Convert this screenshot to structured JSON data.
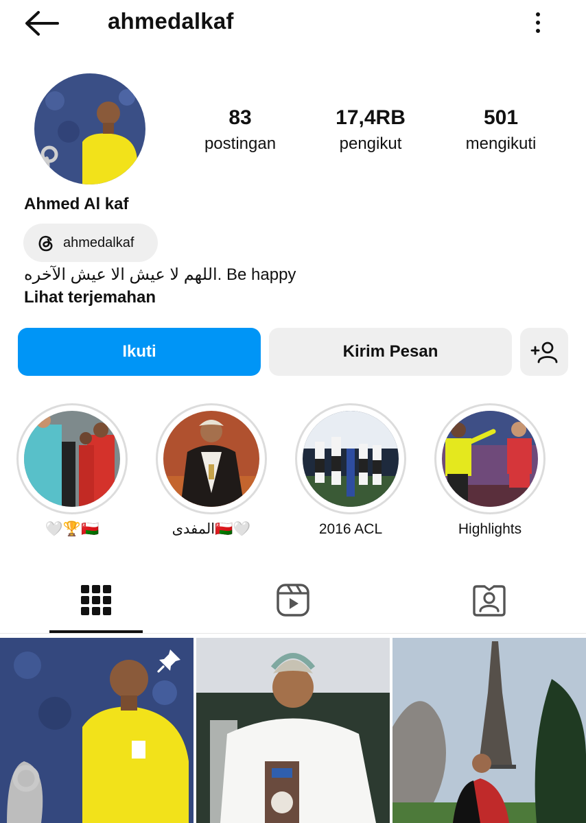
{
  "header": {
    "username": "ahmedalkaf"
  },
  "stats": [
    {
      "value": "83",
      "label": "postingan"
    },
    {
      "value": "17,4RB",
      "label": "pengikut"
    },
    {
      "value": "501",
      "label": "mengikuti"
    }
  ],
  "profile": {
    "full_name": "Ahmed Al kaf",
    "threads_handle": "ahmedalkaf",
    "bio": "اللهم لا عيش الا عيش الآخره. Be happy",
    "translate_link": "Lihat terjemahan"
  },
  "actions": {
    "follow": "Ikuti",
    "message": "Kirim Pesan"
  },
  "highlights": [
    {
      "caption": "🤍🏆🇴🇲"
    },
    {
      "caption": "المفدى🇴🇲🤍"
    },
    {
      "caption": "2016 ACL"
    },
    {
      "caption": "Highlights"
    }
  ],
  "tabs": [
    "posts-grid",
    "reels",
    "tagged"
  ],
  "colors": {
    "follow_button": "#0095f6",
    "secondary_button": "#efefef",
    "referee_shirt": "#f2e21a"
  }
}
